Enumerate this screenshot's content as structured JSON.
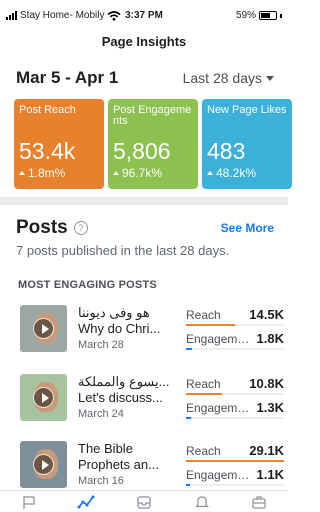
{
  "status_bar": {
    "carrier": "Stay Home- Mobily",
    "time": "3:37 PM",
    "battery": "59%"
  },
  "header": {
    "title": "Page Insights"
  },
  "date_range": "Mar 5 - Apr 1",
  "period": "Last 28 days",
  "cards": [
    {
      "label": "Post Reach",
      "value": "53.4k",
      "change": "1.8m%",
      "color": "#e8812b"
    },
    {
      "label": "Post Engagements",
      "value": "5,806",
      "change": "96.7k%",
      "color": "#8cc04f"
    },
    {
      "label": "New Page Likes",
      "value": "483",
      "change": "48.2k%",
      "color": "#3bb1d9"
    }
  ],
  "posts": {
    "title": "Posts",
    "see_more": "See More",
    "subtitle": "7 posts published in the last 28 days.",
    "section_label": "MOST ENGAGING POSTS",
    "reach_label": "Reach",
    "engagement_label": "Engageme...",
    "items": [
      {
        "title": "هو وفى ديوننا\nWhy do Chri...",
        "date": "March 28",
        "reach": "14.5K",
        "reach_fraction": 0.5,
        "engagement": "1.8K",
        "engagement_fraction": 0.06,
        "thumb_color": "#9aa7a3"
      },
      {
        "title": "يسوع والمملكة...\nLet's discuss...",
        "date": "March 24",
        "reach": "10.8K",
        "reach_fraction": 0.37,
        "engagement": "1.3K",
        "engagement_fraction": 0.05,
        "thumb_color": "#a8c3a0"
      },
      {
        "title": "The Bible\nProphets an...",
        "date": "March 16",
        "reach": "29.1K",
        "reach_fraction": 1.0,
        "engagement": "1.1K",
        "engagement_fraction": 0.04,
        "thumb_color": "#7e8f9c"
      }
    ]
  },
  "colors": {
    "reach_bar": "#e8812b",
    "engagement_bar": "#1877f2",
    "accent": "#1877f2"
  },
  "tab_bar": [
    "flag-icon",
    "insights-icon",
    "inbox-icon",
    "bell-icon",
    "briefcase-icon"
  ]
}
